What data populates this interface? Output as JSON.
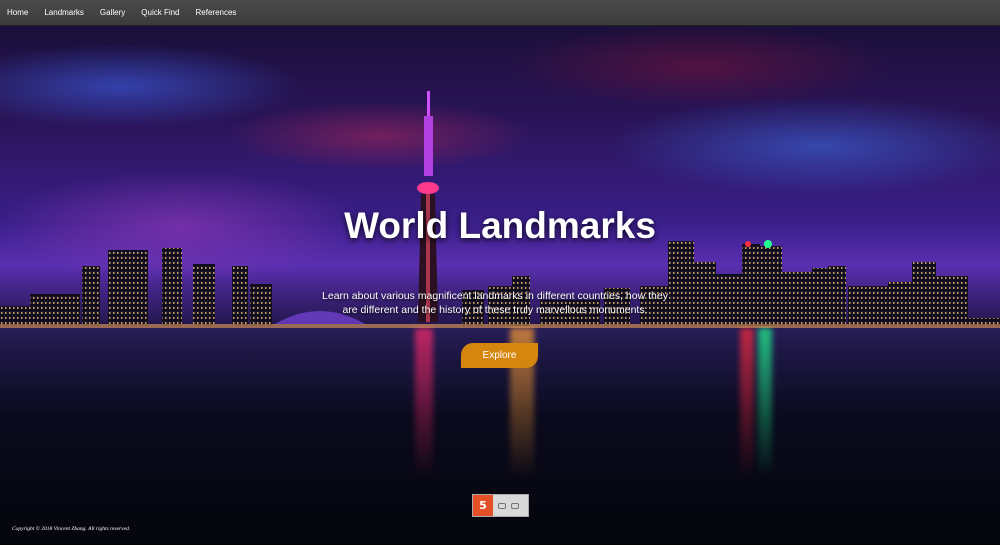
{
  "nav": {
    "items": [
      "Home",
      "Landmarks",
      "Gallery",
      "Quick Find",
      "References"
    ]
  },
  "hero": {
    "title": "World Landmarks",
    "subtitle": "Learn about various magnificent landmarks in different countries, how they are different and the history of these truly marvellous monuments.",
    "cta_label": "Explore"
  },
  "footer": {
    "copyright": "Copyright © 2018 Vincent Zhang. All rights reserved.",
    "badge_icon": "html5-icon"
  },
  "colors": {
    "nav_bg": "#444444",
    "cta_bg": "#d4860f",
    "html5_orange": "#e34f26"
  }
}
